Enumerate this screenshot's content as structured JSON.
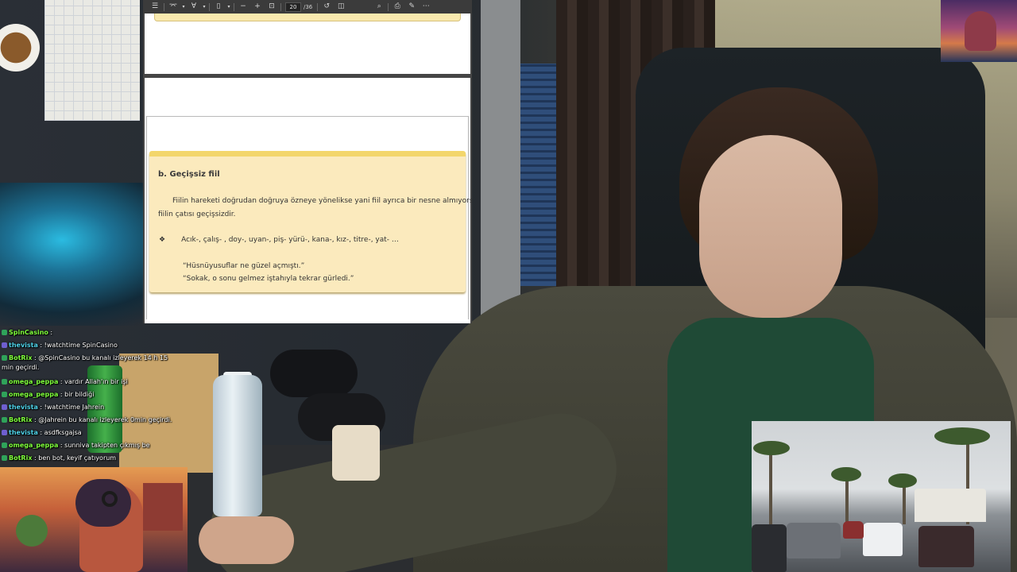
{
  "pdf_viewer": {
    "toolbar": {
      "icons": [
        "sidebar-icon",
        "highlight-icon",
        "draw-icon",
        "fit-page-icon",
        "zoom-out-icon",
        "zoom-in-icon",
        "page-view-icon",
        "rotate-icon",
        "two-page-icon",
        "search-icon",
        "print-icon",
        "save-icon",
        "more-icon"
      ],
      "current_page": "20",
      "total_pages": "/36"
    },
    "note": {
      "title": "b. Geçişsiz fiil",
      "para_line1": "Fiilin hareketi doğrudan doğruya özneye yönelikse yani fiil ayrıca bir nesne almıyorsa",
      "para_line2": "fiilin çatısı geçişsizdir.",
      "bullet_symbol": "❖",
      "bullet_text": "Acık-, çalış- , doy-, uyan-, piş- yürü-, kana-, kız-, titre-, yat- …",
      "quote1": "“Hüsnüyusuflar ne güzel açmıştı.”",
      "quote2": "“Sokak, o sonu gelmez iştahıyla tekrar gürledi.”"
    }
  },
  "chat": {
    "messages": [
      {
        "user": "SpinCasino",
        "sep": " : ",
        "text": "",
        "color": "#7fff3c"
      },
      {
        "user": "thevista",
        "sep": " : ",
        "text": "!watchtime SpinCasino",
        "color": "#4fd2e8"
      },
      {
        "user": "BotRix",
        "sep": " : ",
        "text": "@SpinCasino bu kanalı izleyerek 14 h 15",
        "color": "#7fff3c"
      },
      {
        "user": "",
        "sep": "",
        "text": "min geçirdi.",
        "color": "#ffffff"
      },
      {
        "user": "omega_peppa",
        "sep": " : ",
        "text": "vardır Allah'ın bir işi",
        "color": "#7fff3c"
      },
      {
        "user": "omega_peppa",
        "sep": " : ",
        "text": "bir bildiği",
        "color": "#7fff3c"
      },
      {
        "user": "thevista",
        "sep": " : ",
        "text": "!watchtime Jahrein",
        "color": "#4fd2e8"
      },
      {
        "user": "BotRix",
        "sep": " : ",
        "text": "@Jahrein bu kanalı izleyerek 0min geçirdi.",
        "color": "#7fff3c"
      },
      {
        "user": "thevista",
        "sep": " : ",
        "text": "asdfksgajsa",
        "color": "#4fd2e8"
      },
      {
        "user": "omega_peppa",
        "sep": " : ",
        "text": "sunniva takipten çıkmış be",
        "color": "#7fff3c"
      },
      {
        "user": "BotRix",
        "sep": " : ",
        "text": "ben bot, keyif çatıyorum",
        "color": "#7fff3c"
      }
    ]
  },
  "colors": {
    "note_bg": "#fbeabd",
    "note_top": "#f3d66b",
    "viewer_toolbar": "#3b3b3b"
  }
}
